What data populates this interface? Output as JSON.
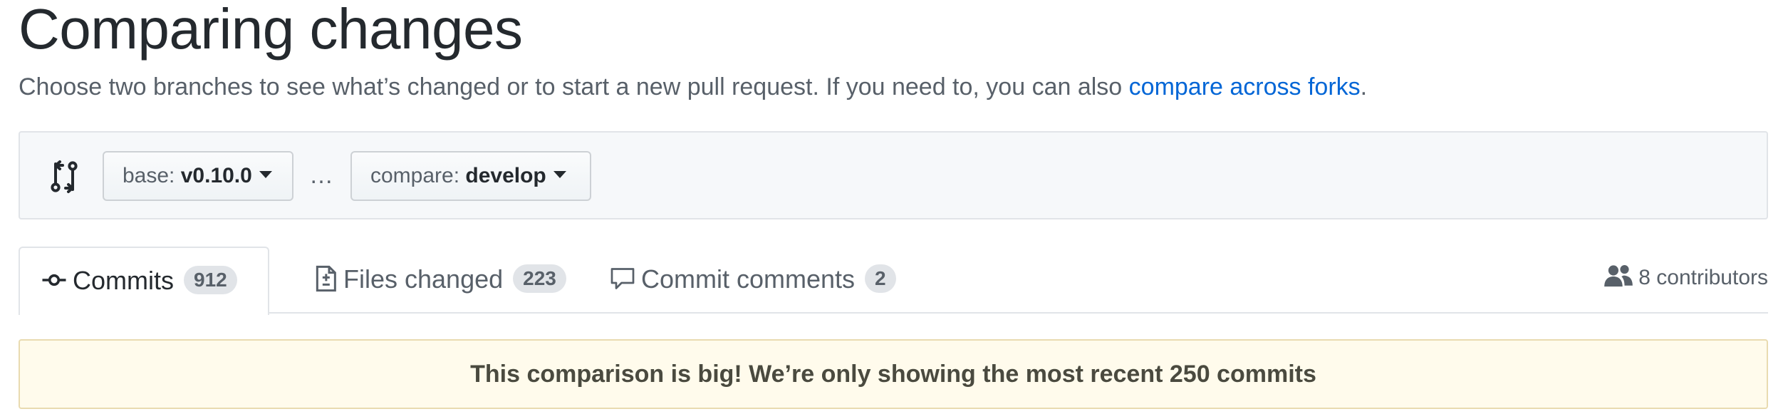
{
  "header": {
    "title": "Comparing changes",
    "lead_text": "Choose two branches to see what’s changed or to start a new pull request. If you need to, you can also ",
    "lead_link": "compare across forks",
    "lead_end": "."
  },
  "range": {
    "base_prefix": "base: ",
    "base_value": "v0.10.0",
    "separator": "…",
    "compare_prefix": "compare: ",
    "compare_value": "develop"
  },
  "tabs": [
    {
      "label": "Commits",
      "count": "912",
      "icon": "commit-icon",
      "selected": true
    },
    {
      "label": "Files changed",
      "count": "223",
      "icon": "file-diff-icon",
      "selected": false
    },
    {
      "label": "Commit comments",
      "count": "2",
      "icon": "comment-icon",
      "selected": false
    }
  ],
  "contributors": {
    "label": "8 contributors",
    "icon": "people-icon"
  },
  "flash": {
    "message": "This comparison is big! We’re only showing the most recent 250 commits"
  },
  "colors": {
    "link": "#0366d6",
    "muted": "#586069",
    "flash_bg": "#fffbec"
  }
}
